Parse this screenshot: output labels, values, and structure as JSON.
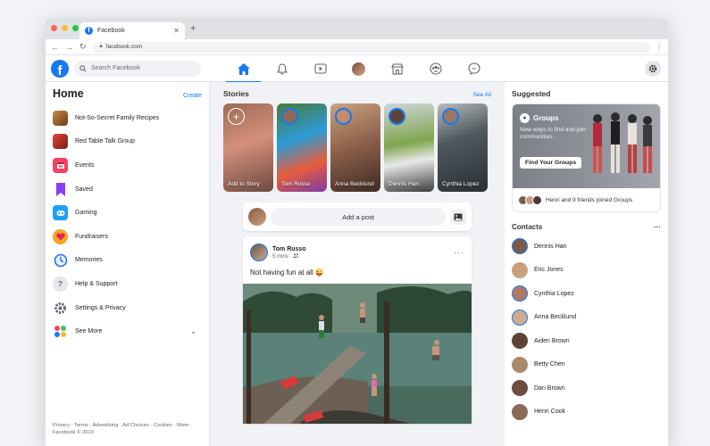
{
  "browser": {
    "tab_title": "Facebook",
    "url": "facebook.com",
    "new_tab": "+"
  },
  "topnav": {
    "search_placeholder": "Search Facebook",
    "icons": [
      "home-icon",
      "notifications-icon",
      "watch-icon",
      "profile-icon",
      "marketplace-icon",
      "groups-icon",
      "messenger-icon"
    ],
    "accent": "#1877f2"
  },
  "left": {
    "title": "Home",
    "create": "Create",
    "items": [
      {
        "label": "Not-So-Secret Family Recipes",
        "icon": "group-avatar"
      },
      {
        "label": "Red Table Talk Group",
        "icon": "group-avatar"
      },
      {
        "label": "Events",
        "icon": "calendar-icon"
      },
      {
        "label": "Saved",
        "icon": "bookmark-icon"
      },
      {
        "label": "Gaming",
        "icon": "gaming-icon"
      },
      {
        "label": "Fundraisers",
        "icon": "heart-icon"
      },
      {
        "label": "Memories",
        "icon": "clock-icon"
      },
      {
        "label": "Help & Support",
        "icon": "question-icon"
      },
      {
        "label": "Settings & Privacy",
        "icon": "gear-icon"
      },
      {
        "label": "See More",
        "icon": "grid-icon"
      }
    ],
    "footer": "Privacy · Terms · Advertising · Ad Choices · Cookies · More · Facebook © 2019"
  },
  "stories": {
    "title": "Stories",
    "see_all": "See All",
    "items": [
      {
        "name": "Add to Story"
      },
      {
        "name": "Tom Russo"
      },
      {
        "name": "Anna Becklund"
      },
      {
        "name": "Dennis Han"
      },
      {
        "name": "Cynthia Lopez"
      }
    ]
  },
  "composer": {
    "placeholder": "Add a post"
  },
  "post": {
    "author": "Tom Russo",
    "time": "5 mins ·",
    "text": "Not having fun at all 😜",
    "more": "···"
  },
  "suggested": {
    "title": "Suggested",
    "card_title": "Groups",
    "card_desc": "New ways to find and join communities.",
    "button": "Find Your Groups",
    "footer": "Henri and 9 friends joined Groups"
  },
  "contacts": {
    "title": "Contacts",
    "more": "···",
    "items": [
      "Dennis Han",
      "Eric Jones",
      "Cynthia Lopez",
      "Anna Becklund",
      "Aiden Brown",
      "Betty Chen",
      "Dan Brown",
      "Henri Cook"
    ]
  }
}
